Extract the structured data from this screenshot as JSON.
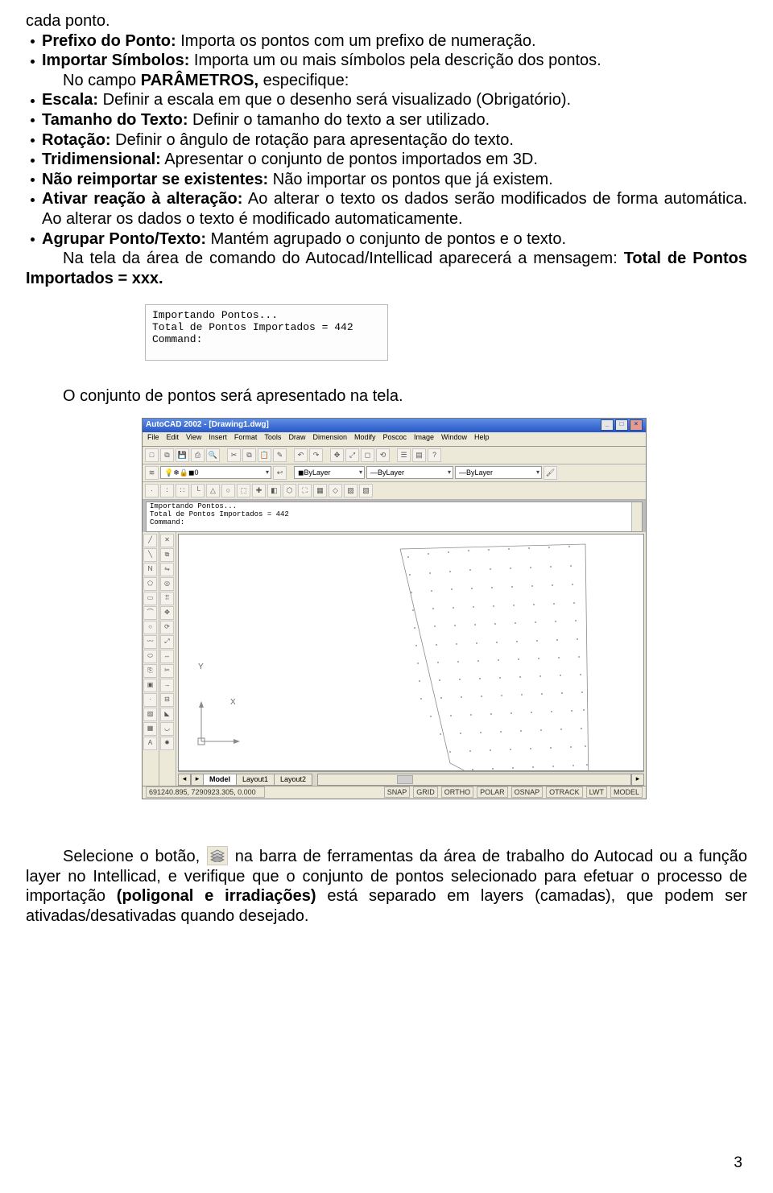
{
  "text": {
    "cadaPonto": "cada ponto.",
    "b_prefixo": "Prefixo do Ponto:",
    "prefixo_rest": " Importa os pontos com um prefixo de numeração.",
    "b_importarSimb": "Importar Símbolos:",
    "importarSimb_rest": " Importa um ou mais símbolos pela descrição dos pontos.",
    "noCampo_lead": "No campo ",
    "noCampo_b": "PARÂMETROS,",
    "noCampo_rest": " especifique:",
    "b_escala": "Escala:",
    "escala_rest": " Definir a escala em que o desenho será visualizado (Obrigatório).",
    "b_tamanho": "Tamanho do Texto:",
    "tamanho_rest": " Definir o tamanho do texto a ser utilizado.",
    "b_rotacao": "Rotação:",
    "rotacao_rest": " Definir o ângulo de rotação para apresentação do texto.",
    "b_tri": "Tridimensional:",
    "tri_rest": " Apresentar o conjunto de pontos importados em 3D.",
    "b_naoReimp": "Não reimportar se existentes:",
    "naoReimp_rest": " Não importar os pontos que já existem.",
    "b_ativar": "Ativar reação à alteração:",
    "ativar_rest": " Ao alterar o texto os dados serão modificados de forma automática. Ao alterar os dados o texto é modificado automaticamente.",
    "b_agrupar": "Agrupar Ponto/Texto:",
    "agrupar_rest": " Mantém agrupado o conjunto de pontos e o texto.",
    "naTela_lead": "Na tela da área de comando do Autocad/Intellicad aparecerá a mensagem: ",
    "naTela_b": "Total de Pontos Importados = xxx.",
    "console_l1": "Importando Pontos...",
    "console_l2": "Total de Pontos Importados = 442",
    "console_l3": "Command:",
    "conj_tela": "O conjunto de pontos será apresentado na tela.",
    "sel_1": "Selecione o botão,",
    "sel_2": "na barra de ferramentas da área de trabalho do Autocad ou a função layer no Intellicad, e verifique que o conjunto de pontos selecionado para efetuar o processo de importação ",
    "sel_b": "(poligonal e irradiações)",
    "sel_3": " está separado em layers (camadas), que podem ser ativadas/desativadas quando desejado.",
    "page_num": "3"
  },
  "acad": {
    "title": "AutoCAD 2002 - [Drawing1.dwg]",
    "menus": [
      "File",
      "Edit",
      "View",
      "Insert",
      "Format",
      "Tools",
      "Draw",
      "Dimension",
      "Modify",
      "Poscoc",
      "Image",
      "Window",
      "Help"
    ],
    "layerDD": "0",
    "colorDD": "ByLayer",
    "ltDD1": "ByLayer",
    "ltDD2": "ByLayer",
    "cmd_l1": "Importando Pontos...",
    "cmd_l2": "Total de Pontos Importados = 442",
    "cmd_l3": "Command:",
    "tabs_nav": [
      "◂",
      "▸"
    ],
    "tabs": [
      "Model",
      "Layout1",
      "Layout2"
    ],
    "status_coords": "691240.895, 7290923.305, 0.000",
    "status_btns": [
      "SNAP",
      "GRID",
      "ORTHO",
      "POLAR",
      "OSNAP",
      "OTRACK",
      "LWT",
      "MODEL"
    ],
    "axis_y": "Y",
    "axis_x": "X"
  }
}
